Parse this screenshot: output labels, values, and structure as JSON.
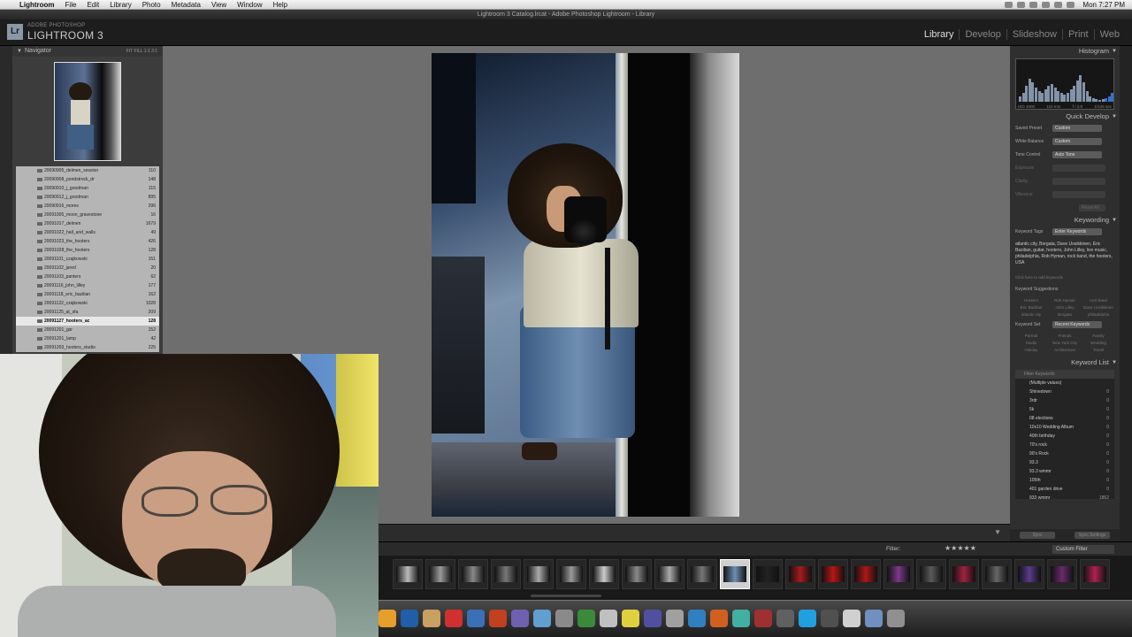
{
  "menubar": {
    "app_name": "Lightroom",
    "menus": [
      "File",
      "Edit",
      "Library",
      "Photo",
      "Metadata",
      "View",
      "Window",
      "Help"
    ],
    "clock": "Mon 7:27 PM"
  },
  "window_title": "Lightroom 3 Catalog.lrcat - Adobe Photoshop Lightroom - Library",
  "brand": {
    "small": "ADOBE PHOTOSHOP",
    "big": "LIGHTROOM 3"
  },
  "modules": [
    "Library",
    "Develop",
    "Slideshow",
    "Print",
    "Web"
  ],
  "navigator": {
    "title": "Navigator",
    "options": "FIT  FILL  1:1  3:1"
  },
  "folders": [
    {
      "name": "20090905_delmen_session",
      "count": "110"
    },
    {
      "name": "20090908_pondstrock_dr",
      "count": "148"
    },
    {
      "name": "20090910_j_goodman",
      "count": "115"
    },
    {
      "name": "20090912_j_goodman",
      "count": "895"
    },
    {
      "name": "20090916_mores",
      "count": "296"
    },
    {
      "name": "20091005_moon_gravestone",
      "count": "16"
    },
    {
      "name": "20091017_delmen",
      "count": "1679"
    },
    {
      "name": "20091022_hall_and_walls",
      "count": "49"
    },
    {
      "name": "20091023_the_hooters",
      "count": "426"
    },
    {
      "name": "20091028_the_hooters",
      "count": "128"
    },
    {
      "name": "20091101_czajkowski",
      "count": "151"
    },
    {
      "name": "20091102_jared",
      "count": "20"
    },
    {
      "name": "20091103_panters",
      "count": "62"
    },
    {
      "name": "20091116_john_lilley",
      "count": "177"
    },
    {
      "name": "20091118_eric_bazilian",
      "count": "162"
    },
    {
      "name": "20091122_czajkowski",
      "count": "1028"
    },
    {
      "name": "20091125_at_sfa",
      "count": "209"
    },
    {
      "name": "20091127_hooters_ac",
      "count": "128"
    },
    {
      "name": "20091201_gsr",
      "count": "152"
    },
    {
      "name": "20091201_lamp",
      "count": "42"
    },
    {
      "name": "20091203_hooters_studio",
      "count": "225"
    }
  ],
  "selected_folder_index": 17,
  "right_panel": {
    "histogram_title": "Histogram",
    "histogram_info": [
      "ISO 1000",
      "110 mm",
      "f / 2.8",
      "1/125 sec"
    ],
    "quick_develop_title": "Quick Develop",
    "saved_preset_label": "Saved Preset",
    "saved_preset_value": "Custom",
    "white_balance_label": "White Balance",
    "white_balance_value": "Custom",
    "tone_control_label": "Tone Control",
    "tone_control_value": "Auto Tone",
    "exposure_label": "Exposure",
    "clarity_label": "Clarity",
    "vibrance_label": "Vibrance",
    "reset_label": "Reset All",
    "keywording_title": "Keywording",
    "keyword_tags_label": "Keyword Tags",
    "keyword_tags_value": "Enter Keywords",
    "keywords_text": "atlantic city, Borgata, Dave Uosikkinen, Eric Bazilian, guitar, hooters, John Lilley, live music, philadelphia, Rob Hyman, rock band, the hooters, USA",
    "keywords_hint": "Click here to add keywords",
    "suggestions_label": "Keyword Suggestions",
    "suggestions": [
      "Hooters",
      "Rob Hyman",
      "rock band",
      "Eric Bazilian",
      "John Lilley",
      "Dave Uosikkinen",
      "atlantic city",
      "Borgata",
      "philadelphia"
    ],
    "keyword_set_label": "Keyword Set",
    "keyword_set_value": "Recent Keywords",
    "keyword_set_items": [
      "Portrait",
      "Friends",
      "Family",
      "Studio",
      "New York City",
      "Wedding",
      "Holiday",
      "Architecture",
      "Travel"
    ],
    "keyword_list_title": "Keyword List",
    "keyword_filter": "Filter Keywords",
    "keyword_list": [
      {
        "name": "(Multiple values)",
        "count": ""
      },
      {
        "name": "Shinedown",
        "count": "0"
      },
      {
        "name": "3rdr",
        "count": "0"
      },
      {
        "name": "5k",
        "count": "0"
      },
      {
        "name": "08 elections",
        "count": "0"
      },
      {
        "name": "10x10 Wedding Album",
        "count": "0"
      },
      {
        "name": "40th birthday",
        "count": "0"
      },
      {
        "name": "70's rock",
        "count": "0"
      },
      {
        "name": "90's Rock",
        "count": "0"
      },
      {
        "name": "93.3",
        "count": "0"
      },
      {
        "name": "93.3 wmmr",
        "count": "0"
      },
      {
        "name": "105th",
        "count": "0"
      },
      {
        "name": "401 garden drive",
        "count": "0"
      },
      {
        "name": "933 wmmr",
        "count": "1862"
      }
    ],
    "bottom_buttons": [
      "Sync",
      "Sync Settings"
    ]
  },
  "filmstrip": {
    "filter_label": "Filter:",
    "stars": "★★★★★",
    "custom_filter": "Custom Filter"
  },
  "dock_icons": [
    "finder-icon",
    "photoshop-icon",
    "preview-icon",
    "ical-icon",
    "mail-icon",
    "firefox-icon",
    "filezilla-icon",
    "twitter-icon",
    "dropbox-icon"
  ]
}
